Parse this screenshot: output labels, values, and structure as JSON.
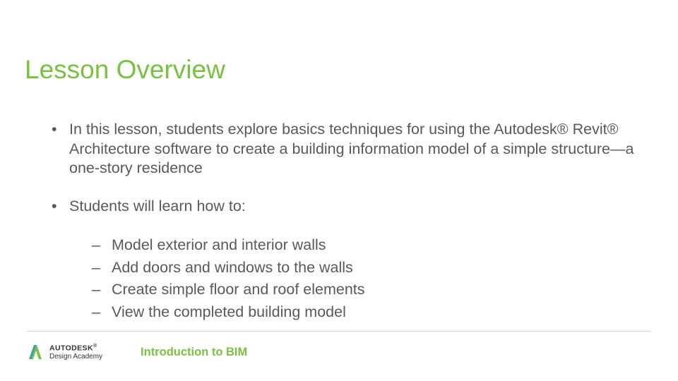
{
  "title": "Lesson Overview",
  "bullets": {
    "b1": "In this lesson, students explore basics techniques for using the Autodesk® Revit® Architecture software to create a building information model of a simple structure—a one-story residence",
    "b2": "Students will learn how to:",
    "subs": {
      "s1": "Model exterior and interior walls",
      "s2": "Add doors and windows to the walls",
      "s3": "Create simple floor and roof elements",
      "s4": "View the completed building model"
    }
  },
  "footer": {
    "brand": "AUTODESK",
    "sub": "Design Academy",
    "pageTitle": "Introduction to BIM"
  }
}
